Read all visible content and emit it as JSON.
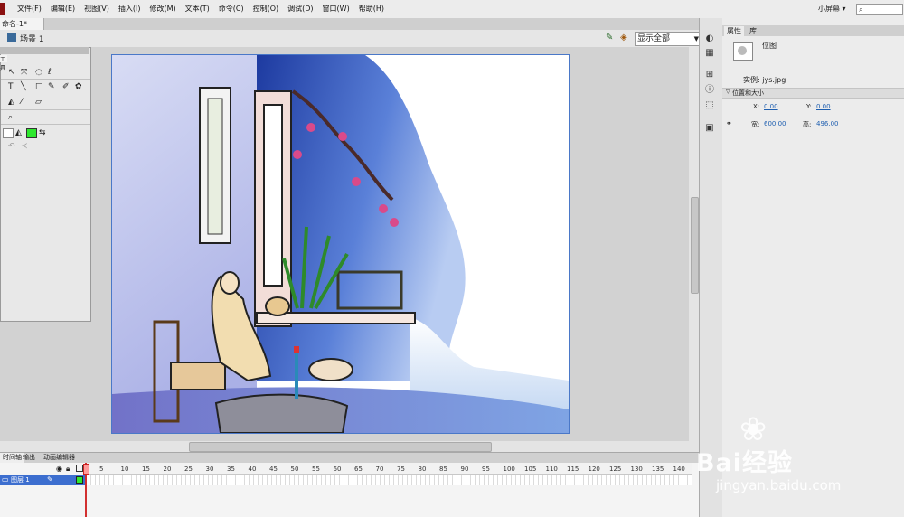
{
  "menu": [
    "文件(F)",
    "编辑(E)",
    "视图(V)",
    "插入(I)",
    "修改(M)",
    "文本(T)",
    "命令(C)",
    "控制(O)",
    "调试(D)",
    "窗口(W)",
    "帮助(H)"
  ],
  "workspace": "小屏幕",
  "document_tab": "命名-1*",
  "scene": "场景 1",
  "zoom": "显示全部",
  "tools_tab": "工具",
  "right_tabs": {
    "properties": "属性",
    "library": "库"
  },
  "properties": {
    "type": "位图",
    "instance_label": "实例:",
    "instance_value": "jys.jpg",
    "section": "位置和大小",
    "x_label": "X:",
    "x_value": "0.00",
    "y_label": "Y:",
    "y_value": "0.00",
    "w_label": "宽:",
    "w_value": "600.00",
    "h_label": "高:",
    "h_value": "496.00"
  },
  "timeline": {
    "tabs": [
      "时间轴",
      "输出",
      "动画编辑器"
    ],
    "layer": "图层 1",
    "frames": [
      "5",
      "10",
      "15",
      "20",
      "25",
      "30",
      "35",
      "40",
      "45",
      "50",
      "55",
      "60",
      "65",
      "70",
      "75",
      "80",
      "85",
      "90",
      "95",
      "100",
      "105",
      "110",
      "115",
      "120",
      "125",
      "130",
      "135",
      "140"
    ]
  },
  "watermark": {
    "brand": "Bai经验",
    "url": "jingyan.baidu.com"
  }
}
